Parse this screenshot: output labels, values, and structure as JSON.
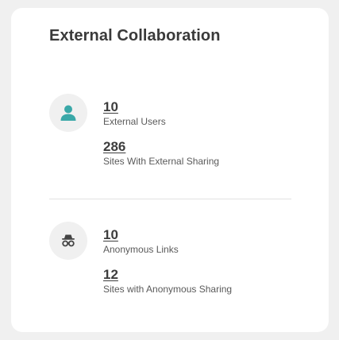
{
  "card": {
    "title": "External Collaboration"
  },
  "sections": [
    {
      "icon": "user-icon",
      "icon_color": "#3aa8a8",
      "stats": [
        {
          "value": "10",
          "label": "External Users"
        },
        {
          "value": "286",
          "label": "Sites With External Sharing"
        }
      ]
    },
    {
      "icon": "incognito-icon",
      "icon_color": "#444444",
      "stats": [
        {
          "value": "10",
          "label": "Anonymous Links"
        },
        {
          "value": "12",
          "label": "Sites with Anonymous Sharing"
        }
      ]
    }
  ]
}
